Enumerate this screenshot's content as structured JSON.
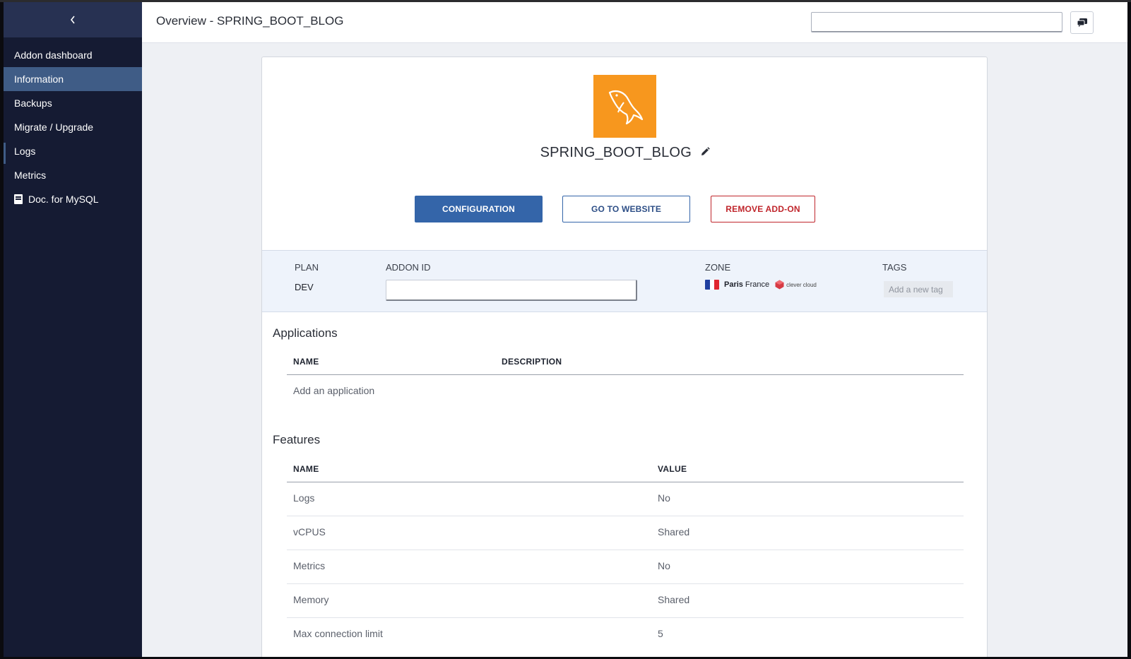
{
  "sidebar": {
    "back_glyph": "‹",
    "items": [
      {
        "label": "Addon dashboard"
      },
      {
        "label": "Information"
      },
      {
        "label": "Backups"
      },
      {
        "label": "Migrate / Upgrade"
      },
      {
        "label": "Logs"
      },
      {
        "label": "Metrics"
      },
      {
        "label": "Doc. for MySQL"
      }
    ],
    "active_item": "Information"
  },
  "header": {
    "title": "Overview - SPRING_BOOT_BLOG",
    "search_value": "",
    "chat_icon": "chat-icon"
  },
  "addon": {
    "logo_icon": "mysql-dolphin-icon",
    "name": "SPRING_BOOT_BLOG",
    "edit_icon": "pencil-icon"
  },
  "actions": {
    "configuration": "CONFIGURATION",
    "website": "GO TO WEBSITE",
    "remove": "REMOVE ADD-ON"
  },
  "info": {
    "plan_label": "PLAN",
    "plan_value": "DEV",
    "addon_id_label": "ADDON ID",
    "addon_id_value": "",
    "zone_label": "ZONE",
    "zone_city": "Paris",
    "zone_country": "France",
    "zone_provider": "clever cloud",
    "tags_label": "TAGS",
    "tags_placeholder": "Add a new tag"
  },
  "applications": {
    "title": "Applications",
    "headers": [
      "NAME",
      "DESCRIPTION"
    ],
    "empty_action": "Add an application"
  },
  "features": {
    "title": "Features",
    "headers": [
      "NAME",
      "VALUE"
    ],
    "rows": [
      {
        "name": "Logs",
        "value": "No"
      },
      {
        "name": "vCPUS",
        "value": "Shared"
      },
      {
        "name": "Metrics",
        "value": "No"
      },
      {
        "name": "Memory",
        "value": "Shared"
      },
      {
        "name": "Max connection limit",
        "value": "5"
      }
    ]
  },
  "colors": {
    "sidebar_bg": "#151b33",
    "active_item": "#3f5c86",
    "primary": "#3465a9",
    "danger": "#c0262c",
    "mysql_orange": "#f7971e"
  }
}
